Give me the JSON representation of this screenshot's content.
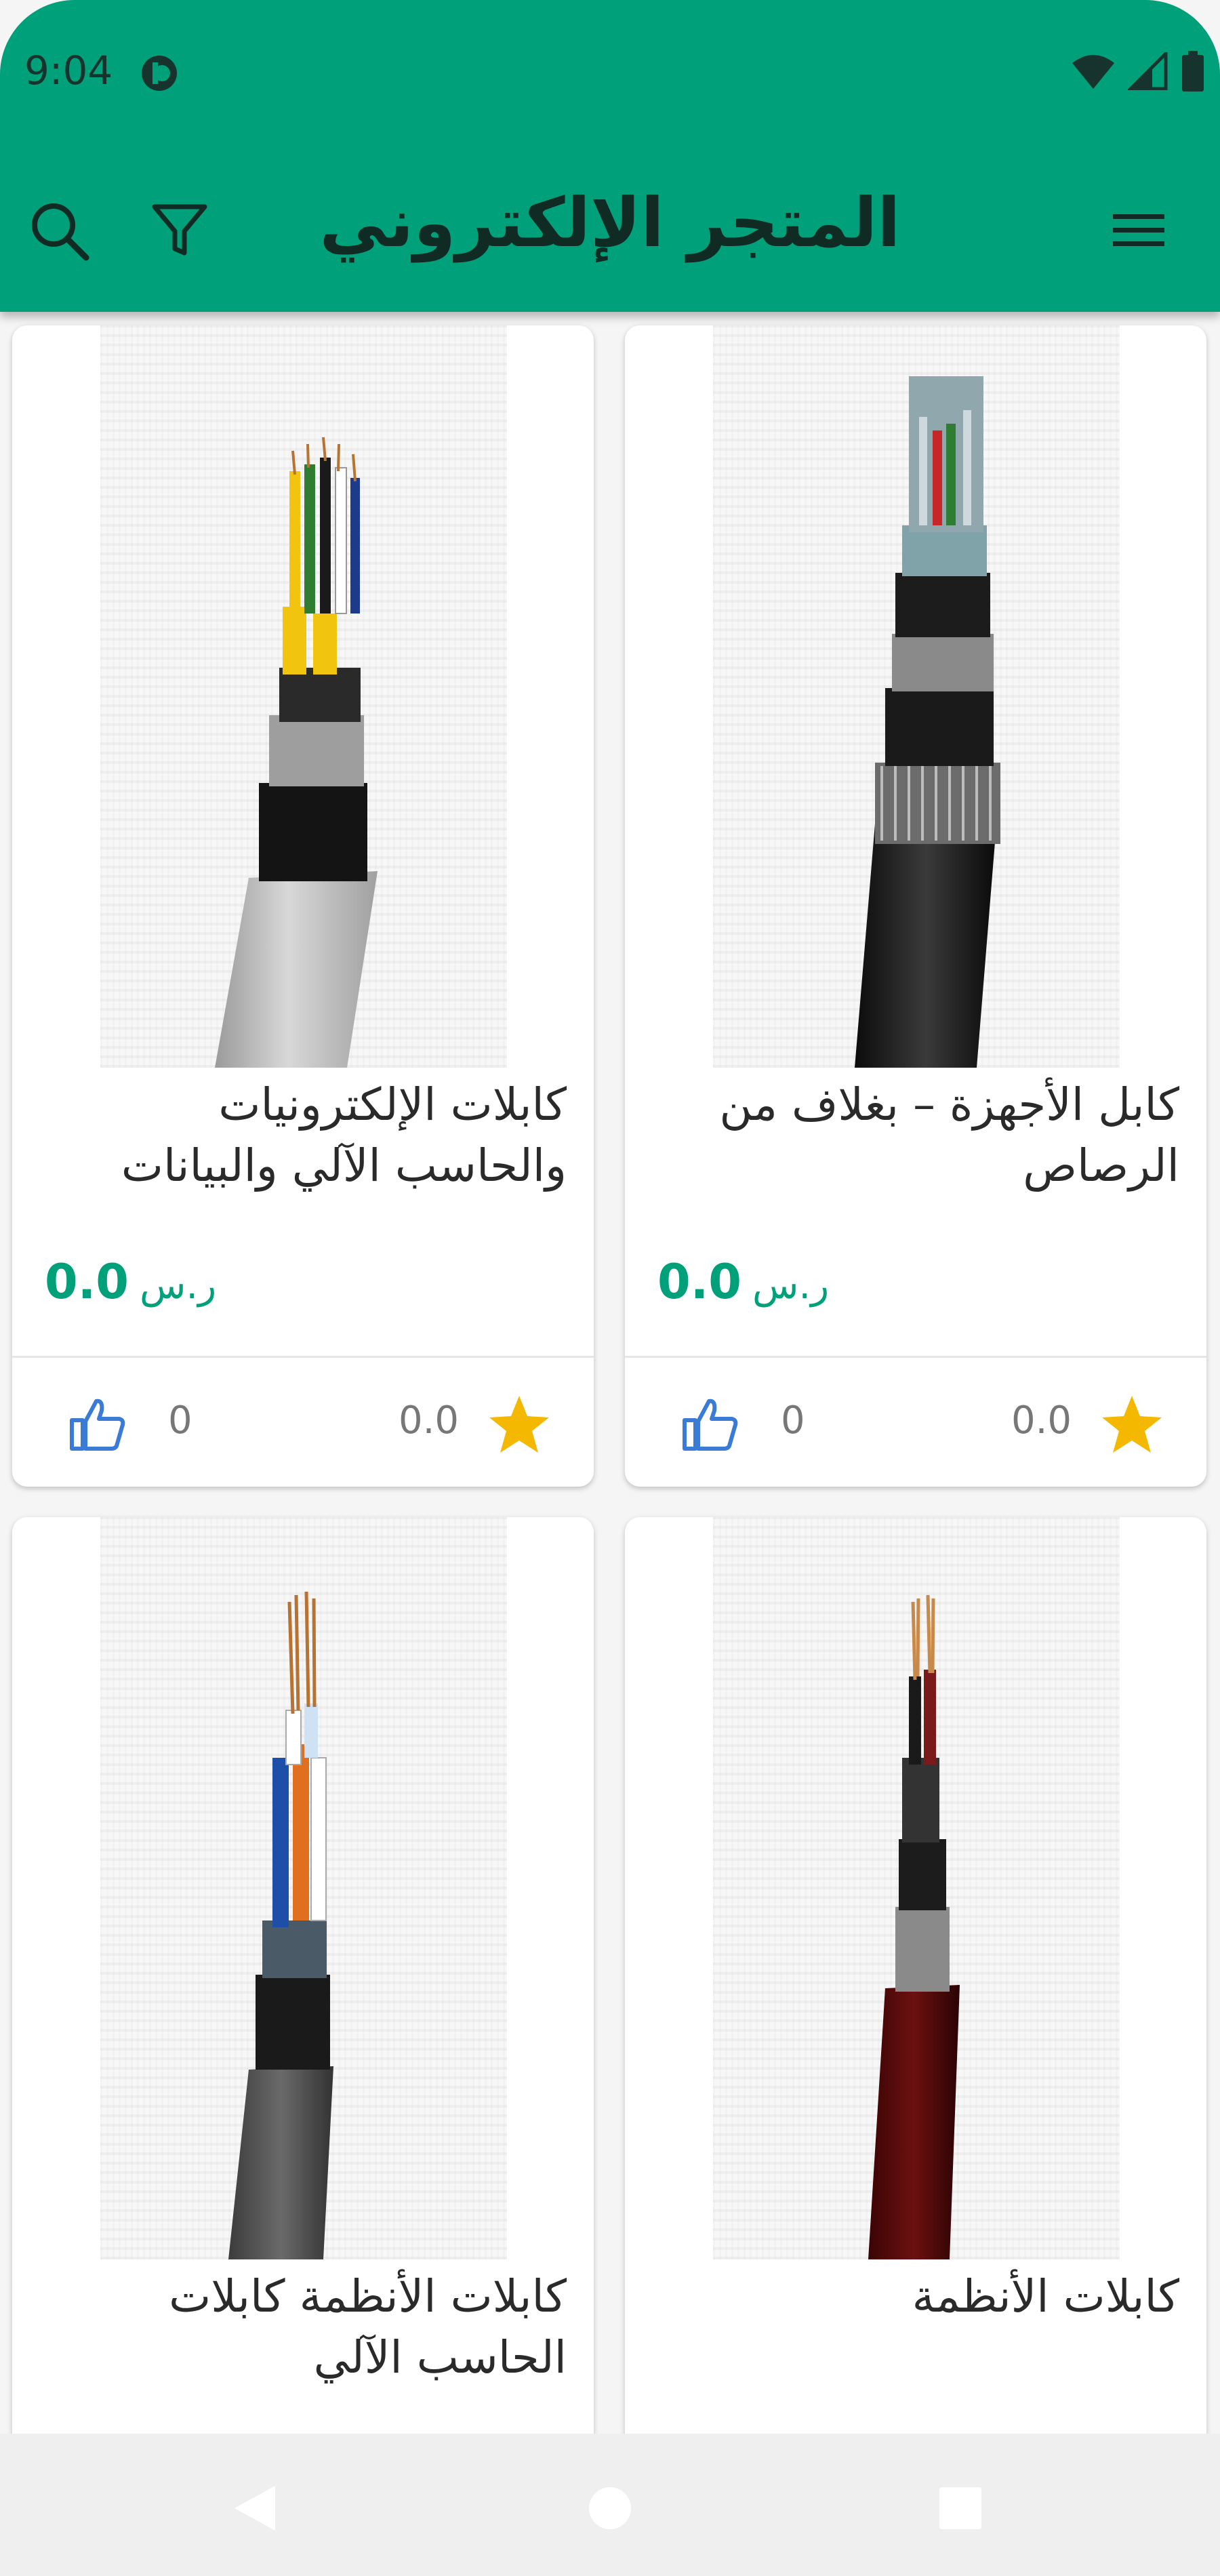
{
  "status": {
    "time": "9:04"
  },
  "toolbar": {
    "title": "المتجر الإلكتروني",
    "search_icon": "search-icon",
    "filter_icon": "filter-icon",
    "menu_icon": "menu-icon"
  },
  "colors": {
    "primary": "#00a07a",
    "price": "#00a07a",
    "star": "#f5b800",
    "like": "#3a7bd5"
  },
  "products": [
    {
      "title": "كابل الأجهزة – بغلاف من الرصاص",
      "price": "0.0",
      "currency": "ر.س",
      "rating": "0.0",
      "likes": "0"
    },
    {
      "title": "كابلات الإلكترونيات والحاسب الآلي والبيانات",
      "price": "0.0",
      "currency": "ر.س",
      "rating": "0.0",
      "likes": "0"
    },
    {
      "title": "كابلات الأنظمة",
      "price": "",
      "currency": "",
      "rating": "",
      "likes": ""
    },
    {
      "title": "كابلات الأنظمة كابلات الحاسب الآلي",
      "price": "",
      "currency": "",
      "rating": "",
      "likes": ""
    }
  ]
}
